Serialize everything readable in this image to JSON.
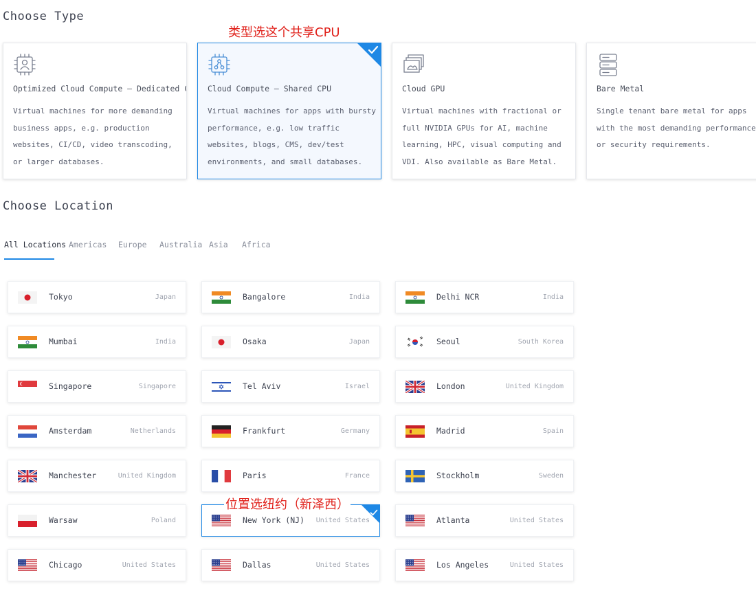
{
  "type_section": {
    "title": "Choose Type",
    "annotation": "类型选这个共享CPU",
    "cards": [
      {
        "name": "Optimized Cloud Compute — Dedicated CPU",
        "desc": "Virtual machines for more demanding business apps, e.g. production websites, CI/CD, video transcoding, or larger databases.",
        "icon": "optimized-compute-icon",
        "selected": false
      },
      {
        "name": "Cloud Compute — Shared CPU",
        "desc": "Virtual machines for apps with bursty performance, e.g. low traffic websites, blogs, CMS, dev/test environments, and small databases.",
        "icon": "shared-cpu-icon",
        "selected": true
      },
      {
        "name": "Cloud GPU",
        "desc": "Virtual machines with fractional or full NVIDIA GPUs for AI, machine learning, HPC, visual computing and VDI. Also available as Bare Metal.",
        "icon": "gpu-icon",
        "selected": false
      },
      {
        "name": "Bare Metal",
        "desc": "Single tenant bare metal for apps with the most demanding performance or security requirements.",
        "icon": "server-rack-icon",
        "selected": false
      }
    ]
  },
  "location_section": {
    "title": "Choose Location",
    "annotation": "位置选纽约（新泽西）",
    "tabs": [
      "All Locations",
      "Americas",
      "Europe",
      "Australia",
      "Asia",
      "Africa"
    ],
    "active_tab": "All Locations",
    "columns": [
      [
        {
          "city": "Tokyo",
          "country": "Japan",
          "flag": "jp"
        },
        {
          "city": "Mumbai",
          "country": "India",
          "flag": "in"
        },
        {
          "city": "Singapore",
          "country": "Singapore",
          "flag": "sg"
        },
        {
          "city": "Amsterdam",
          "country": "Netherlands",
          "flag": "nl"
        },
        {
          "city": "Manchester",
          "country": "United Kingdom",
          "flag": "gb"
        },
        {
          "city": "Warsaw",
          "country": "Poland",
          "flag": "pl"
        },
        {
          "city": "Chicago",
          "country": "United States",
          "flag": "us"
        }
      ],
      [
        {
          "city": "Bangalore",
          "country": "India",
          "flag": "in"
        },
        {
          "city": "Osaka",
          "country": "Japan",
          "flag": "jp"
        },
        {
          "city": "Tel Aviv",
          "country": "Israel",
          "flag": "il"
        },
        {
          "city": "Frankfurt",
          "country": "Germany",
          "flag": "de"
        },
        {
          "city": "Paris",
          "country": "France",
          "flag": "fr"
        },
        {
          "city": "New York (NJ)",
          "country": "United States",
          "flag": "us",
          "selected": true
        },
        {
          "city": "Dallas",
          "country": "United States",
          "flag": "us"
        }
      ],
      [
        {
          "city": "Delhi NCR",
          "country": "India",
          "flag": "in"
        },
        {
          "city": "Seoul",
          "country": "South Korea",
          "flag": "kr"
        },
        {
          "city": "London",
          "country": "United Kingdom",
          "flag": "gb"
        },
        {
          "city": "Madrid",
          "country": "Spain",
          "flag": "es"
        },
        {
          "city": "Stockholm",
          "country": "Sweden",
          "flag": "se"
        },
        {
          "city": "Atlanta",
          "country": "United States",
          "flag": "us"
        },
        {
          "city": "Los Angeles",
          "country": "United States",
          "flag": "us"
        }
      ]
    ]
  },
  "colors": {
    "accent": "#1e88e5",
    "annotation": "#e0201a"
  }
}
